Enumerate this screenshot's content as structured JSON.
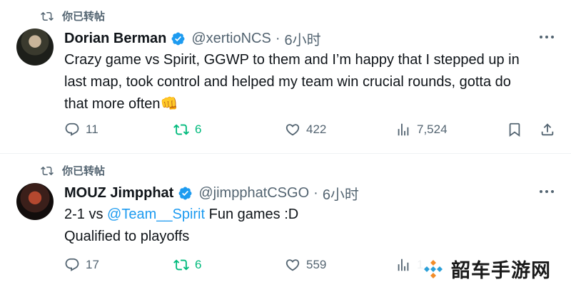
{
  "tweets": [
    {
      "repost_label": "你已转帖",
      "name": "Dorian Berman",
      "handle": "@xertioNCS",
      "dot": "·",
      "time": "6小时",
      "text_lines": [
        "Crazy game vs Spirit, GGWP to them and I’m happy that I stepped up in",
        "last map, took control and helped my team win crucial rounds, gotta do",
        "that more often👊"
      ],
      "replies": "11",
      "reposts": "6",
      "likes": "422",
      "views": "7,524"
    },
    {
      "repost_label": "你已转帖",
      "name": "MOUZ Jimpphat",
      "handle": "@jimpphatCSGO",
      "dot": "·",
      "time": "6小时",
      "line1_prefix": "2-1 vs ",
      "line1_mention": "@Team__Spirit",
      "line1_suffix": " Fun games :D",
      "line2": "Qualified to playoffs",
      "replies": "17",
      "reposts": "6",
      "likes": "559",
      "views": "1."
    }
  ],
  "watermark": {
    "text": "韶车手游网"
  },
  "colors": {
    "accent": "#1d9bf0",
    "repost_green": "#00ba7c",
    "secondary_text": "#536471"
  }
}
